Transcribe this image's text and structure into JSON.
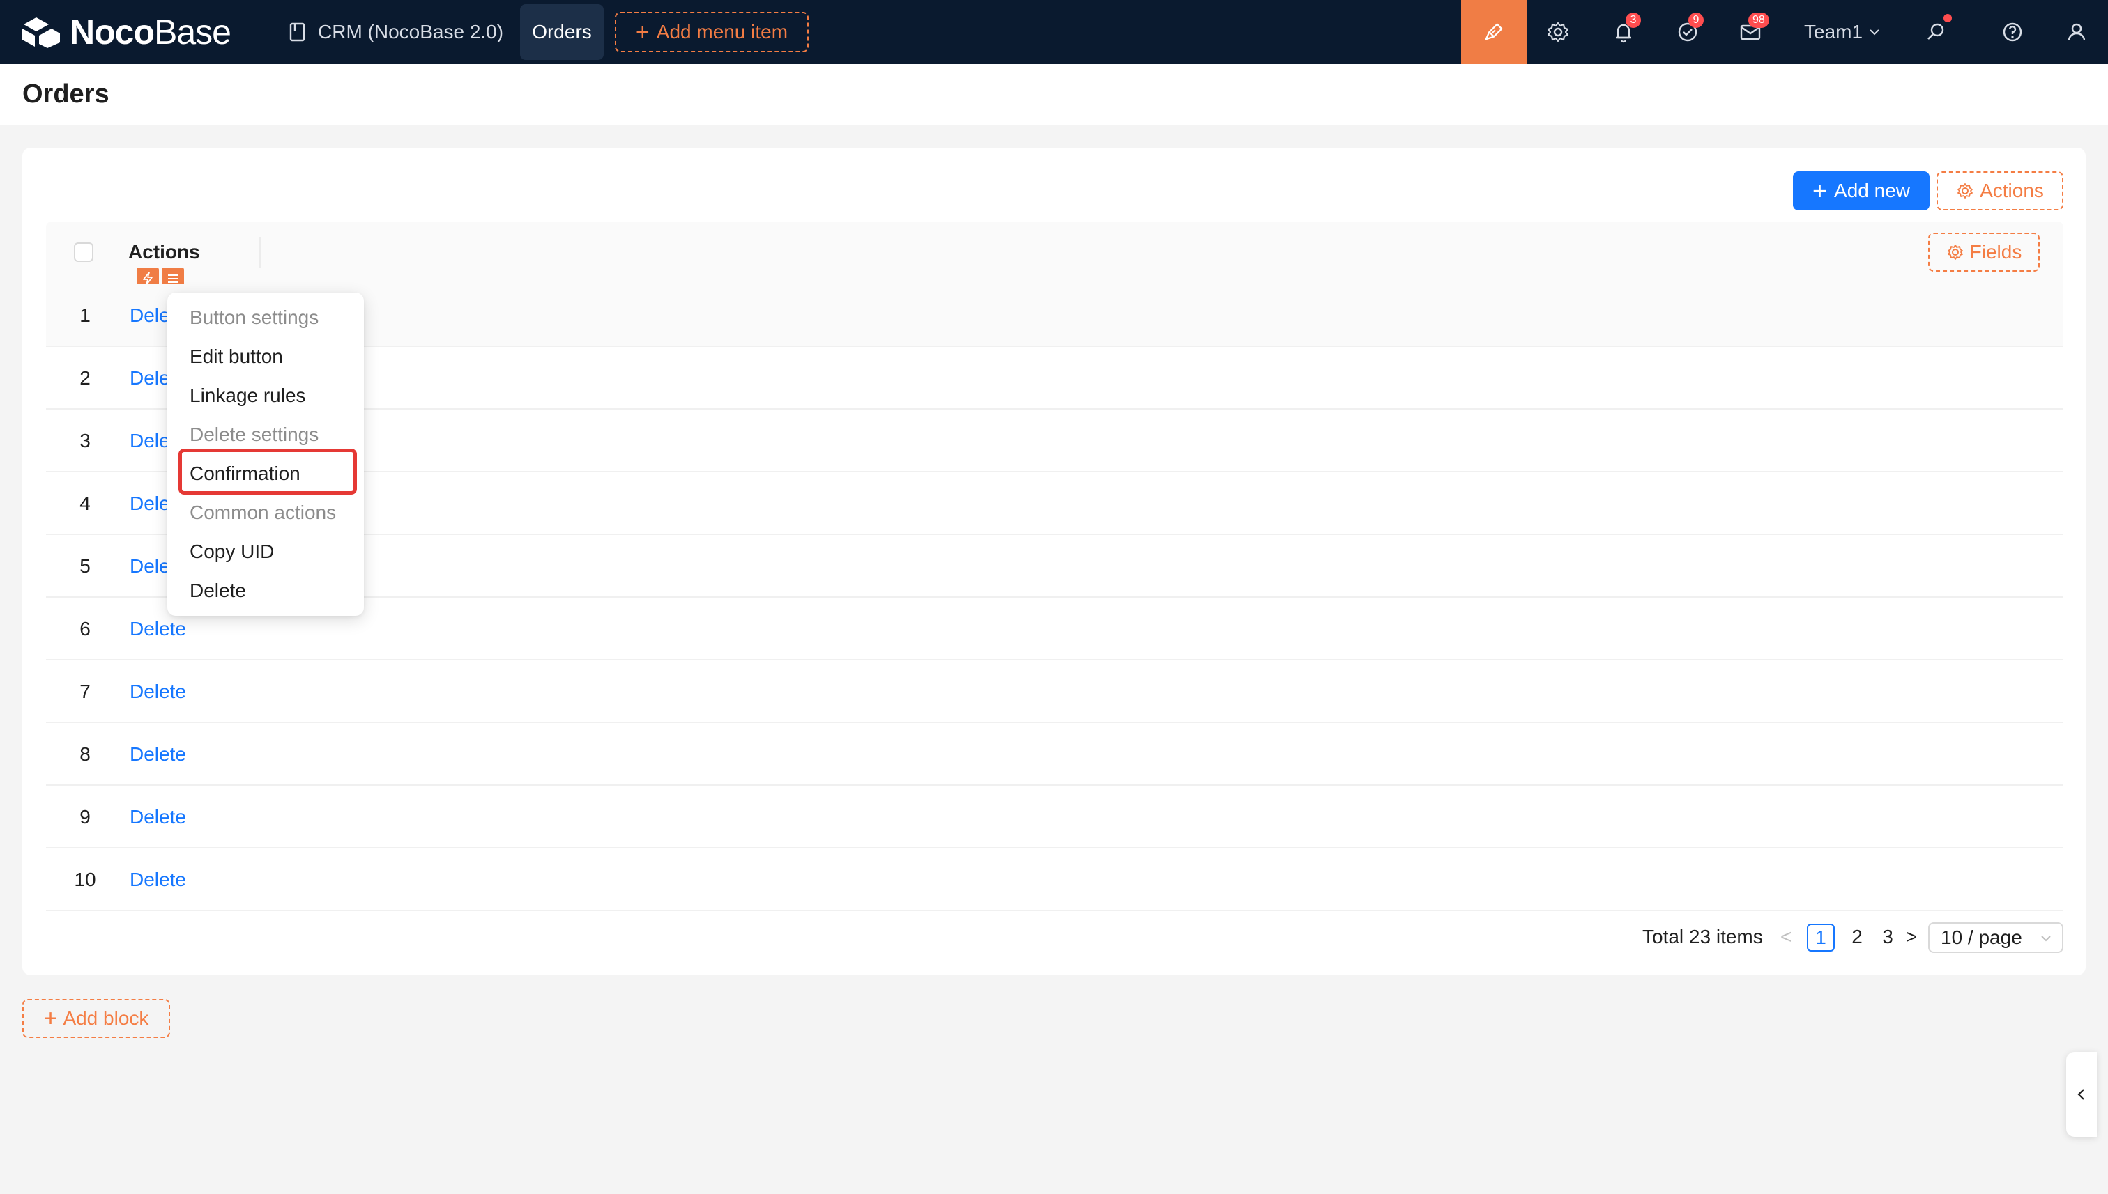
{
  "app": {
    "logo_bold": "Noco",
    "logo_light": "Base",
    "crm_label": "CRM (NocoBase 2.0)",
    "orders_tab": "Orders",
    "add_menu_item": "Add menu item",
    "plus": "+",
    "badges": {
      "notifications": "3",
      "tasks": "9",
      "messages": "98"
    },
    "team": "Team1"
  },
  "page": {
    "title": "Orders"
  },
  "toolbar": {
    "add_new": "Add new",
    "actions": "Actions",
    "fields": "Fields"
  },
  "table": {
    "column_actions": "Actions",
    "rows": [
      {
        "num": "1",
        "action": "Delete"
      },
      {
        "num": "2",
        "action": "Delete"
      },
      {
        "num": "3",
        "action": "Delete"
      },
      {
        "num": "4",
        "action": "Delete"
      },
      {
        "num": "5",
        "action": "Delete"
      },
      {
        "num": "6",
        "action": "Delete"
      },
      {
        "num": "7",
        "action": "Delete"
      },
      {
        "num": "8",
        "action": "Delete"
      },
      {
        "num": "9",
        "action": "Delete"
      },
      {
        "num": "10",
        "action": "Delete"
      }
    ]
  },
  "pagination": {
    "total": "Total 23 items",
    "prev": "<",
    "pages": [
      "1",
      "2",
      "3"
    ],
    "next": ">",
    "page_size": "10 / page"
  },
  "add_block": "Add block",
  "menu": {
    "items": [
      {
        "label": "Button settings",
        "type": "group"
      },
      {
        "label": "Edit button",
        "type": "item"
      },
      {
        "label": "Linkage rules",
        "type": "item"
      },
      {
        "label": "Delete settings",
        "type": "group"
      },
      {
        "label": "Confirmation",
        "type": "item",
        "highlighted": true
      },
      {
        "label": "Common actions",
        "type": "group"
      },
      {
        "label": "Copy UID",
        "type": "item"
      },
      {
        "label": "Delete",
        "type": "item"
      }
    ]
  },
  "colors": {
    "topbar": "#0a1a2f",
    "accent_orange": "#f47d44",
    "primary_blue": "#1677ff",
    "badge_red": "#ff4d4f",
    "highlight_red": "#e53935"
  }
}
